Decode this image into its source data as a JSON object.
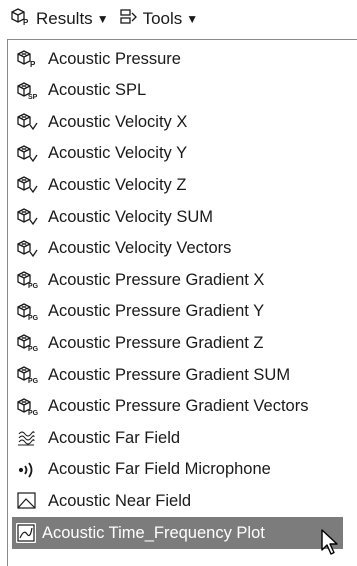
{
  "toolbar": {
    "results_label": "Results",
    "tools_label": "Tools"
  },
  "menu": {
    "items": [
      {
        "label": "Acoustic Pressure",
        "icon": "cube-p-icon"
      },
      {
        "label": "Acoustic SPL",
        "icon": "cube-sp-icon"
      },
      {
        "label": "Acoustic Velocity X",
        "icon": "cube-v-icon"
      },
      {
        "label": "Acoustic Velocity Y",
        "icon": "cube-v-icon"
      },
      {
        "label": "Acoustic Velocity Z",
        "icon": "cube-v-icon"
      },
      {
        "label": "Acoustic Velocity SUM",
        "icon": "cube-v-icon"
      },
      {
        "label": "Acoustic Velocity Vectors",
        "icon": "cube-v-icon"
      },
      {
        "label": "Acoustic Pressure Gradient X",
        "icon": "cube-pg-icon"
      },
      {
        "label": "Acoustic Pressure Gradient Y",
        "icon": "cube-pg-icon"
      },
      {
        "label": "Acoustic Pressure Gradient Z",
        "icon": "cube-pg-icon"
      },
      {
        "label": "Acoustic Pressure Gradient SUM",
        "icon": "cube-pg-icon"
      },
      {
        "label": "Acoustic Pressure Gradient Vectors",
        "icon": "cube-pg-icon"
      },
      {
        "label": "Acoustic Far Field",
        "icon": "far-field-icon"
      },
      {
        "label": "Acoustic Far Field Microphone",
        "icon": "microphone-icon"
      },
      {
        "label": "Acoustic Near Field",
        "icon": "near-field-icon"
      },
      {
        "label": "Acoustic Time_Frequency Plot",
        "icon": "plot-icon"
      }
    ],
    "selected_index": 15
  },
  "colors": {
    "selection_bg": "#7c7c7c",
    "menu_border": "#8a8a8a"
  }
}
